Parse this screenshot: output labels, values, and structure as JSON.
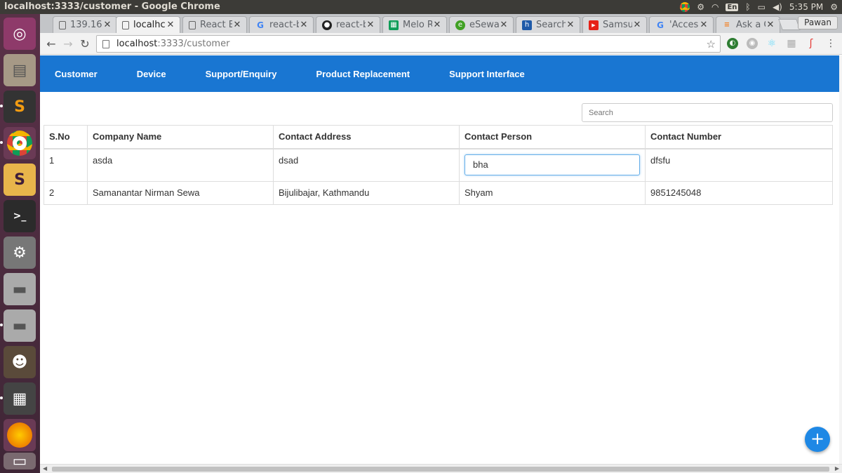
{
  "os": {
    "window_title": "localhost:3333/customer - Google Chrome",
    "clock": "5:35 PM",
    "keyboard_layout": "En",
    "icons": [
      "chrome-icon",
      "settings-gear-icon",
      "wifi-icon",
      "bluetooth-icon",
      "battery-icon",
      "volume-icon"
    ]
  },
  "launcher": {
    "icons": [
      "ubuntu-dash-icon",
      "files-icon",
      "sublime-text-icon",
      "chrome-icon",
      "slack-icon",
      "terminal-icon",
      "system-settings-icon",
      "disk-icon",
      "disk-icon",
      "gimp-icon",
      "video-editor-icon",
      "firefox-icon",
      "trash-icon"
    ]
  },
  "browser": {
    "tabs": [
      {
        "label": "139.16",
        "icon": "page-icon"
      },
      {
        "label": "localhc",
        "icon": "page-icon",
        "active": true
      },
      {
        "label": "React E",
        "icon": "page-icon"
      },
      {
        "label": "react-b",
        "icon": "google-icon"
      },
      {
        "label": "react-b",
        "icon": "github-icon"
      },
      {
        "label": "Melo R",
        "icon": "sheets-icon"
      },
      {
        "label": "eSewa",
        "icon": "esewa-icon"
      },
      {
        "label": "Search",
        "icon": "search-site-icon"
      },
      {
        "label": "Samsu",
        "icon": "youtube-icon"
      },
      {
        "label": "'Acces",
        "icon": "google-icon"
      },
      {
        "label": "Ask a C",
        "icon": "stackoverflow-icon"
      }
    ],
    "user_name": "Pawan",
    "url_host": "localhost",
    "url_path": ":3333/customer"
  },
  "nav": {
    "items": [
      "Customer",
      "Device",
      "Support/Enquiry",
      "Product Replacement",
      "Support Interface"
    ]
  },
  "search": {
    "placeholder": "Search"
  },
  "table": {
    "headers": [
      "S.No",
      "Company Name",
      "Contact Address",
      "Contact Person",
      "Contact Number"
    ],
    "rows": [
      {
        "sno": "1",
        "company": "asda",
        "address": "dsad",
        "person": "bha",
        "number": "dfsfu"
      },
      {
        "sno": "2",
        "company": "Samanantar Nirman Sewa",
        "address": "Bijulibajar, Kathmandu",
        "person": "Shyam",
        "number": "9851245048"
      }
    ]
  },
  "fab": {
    "label": "+"
  },
  "colors": {
    "primary": "#1976d2",
    "fab": "#1e88e5",
    "launcher": "#4a2c3e",
    "titlebar": "#3c3b37"
  }
}
